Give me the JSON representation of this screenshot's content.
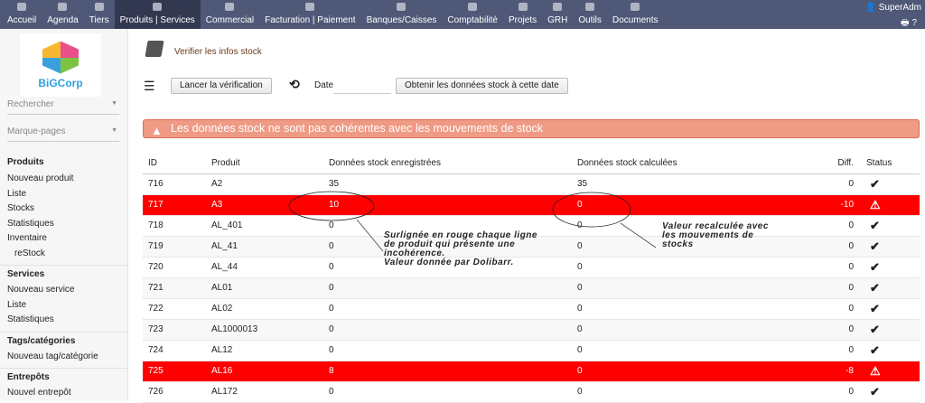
{
  "topbar": {
    "tabs": [
      "Accueil",
      "Agenda",
      "Tiers",
      "Produits | Services",
      "Commercial",
      "Facturation | Paiement",
      "Banques/Caisses",
      "Comptabilité",
      "Projets",
      "GRH",
      "Outils",
      "Documents"
    ],
    "user": "SuperAdm"
  },
  "sidebar": {
    "company": "BiGCorp",
    "search": "Rechercher",
    "bookmarks": "Marque-pages",
    "sections": [
      {
        "title": "Produits",
        "items": [
          "Nouveau produit",
          "Liste",
          "Stocks",
          "Statistiques",
          "Inventaire",
          "reStock"
        ]
      },
      {
        "title": "Services",
        "items": [
          "Nouveau service",
          "Liste",
          "Statistiques"
        ]
      },
      {
        "title": "Tags/catégories",
        "items": [
          "Nouveau tag/catégorie"
        ]
      },
      {
        "title": "Entrepôts",
        "items": [
          "Nouvel entrepôt"
        ]
      }
    ]
  },
  "page": {
    "title": "Verifier les infos stock",
    "run_button": "Lancer la vérification",
    "date_label": "Date",
    "date_value": "",
    "get_button": "Obtenir les données stock à cette date",
    "alert": "Les données stock ne sont pas cohérentes avec les mouvements de stock"
  },
  "table": {
    "headers": [
      "ID",
      "Produit",
      "Données stock enregistrées",
      "Données stock calculées",
      "Diff.",
      "Status"
    ],
    "rows": [
      [
        "716",
        "A2",
        "35",
        "35",
        "0",
        "ok"
      ],
      [
        "717",
        "A3",
        "10",
        "0",
        "-10",
        "warn"
      ],
      [
        "718",
        "AL_401",
        "0",
        "0",
        "0",
        "ok"
      ],
      [
        "719",
        "AL_41",
        "0",
        "0",
        "0",
        "ok"
      ],
      [
        "720",
        "AL_44",
        "0",
        "0",
        "0",
        "ok"
      ],
      [
        "721",
        "AL01",
        "0",
        "0",
        "0",
        "ok"
      ],
      [
        "722",
        "AL02",
        "0",
        "0",
        "0",
        "ok"
      ],
      [
        "723",
        "AL1000013",
        "0",
        "0",
        "0",
        "ok"
      ],
      [
        "724",
        "AL12",
        "0",
        "0",
        "0",
        "ok"
      ],
      [
        "725",
        "AL16",
        "8",
        "0",
        "-8",
        "warn"
      ],
      [
        "726",
        "AL172",
        "0",
        "0",
        "0",
        "ok"
      ]
    ]
  },
  "annotations": {
    "left": [
      "Surlignée en rouge chaque ligne",
      "de produit qui présente une",
      "incohérence.",
      "Valeur donnée par Dolibarr."
    ],
    "right": [
      "Valeur recalculée avec",
      "les mouvements de",
      "stocks"
    ]
  }
}
